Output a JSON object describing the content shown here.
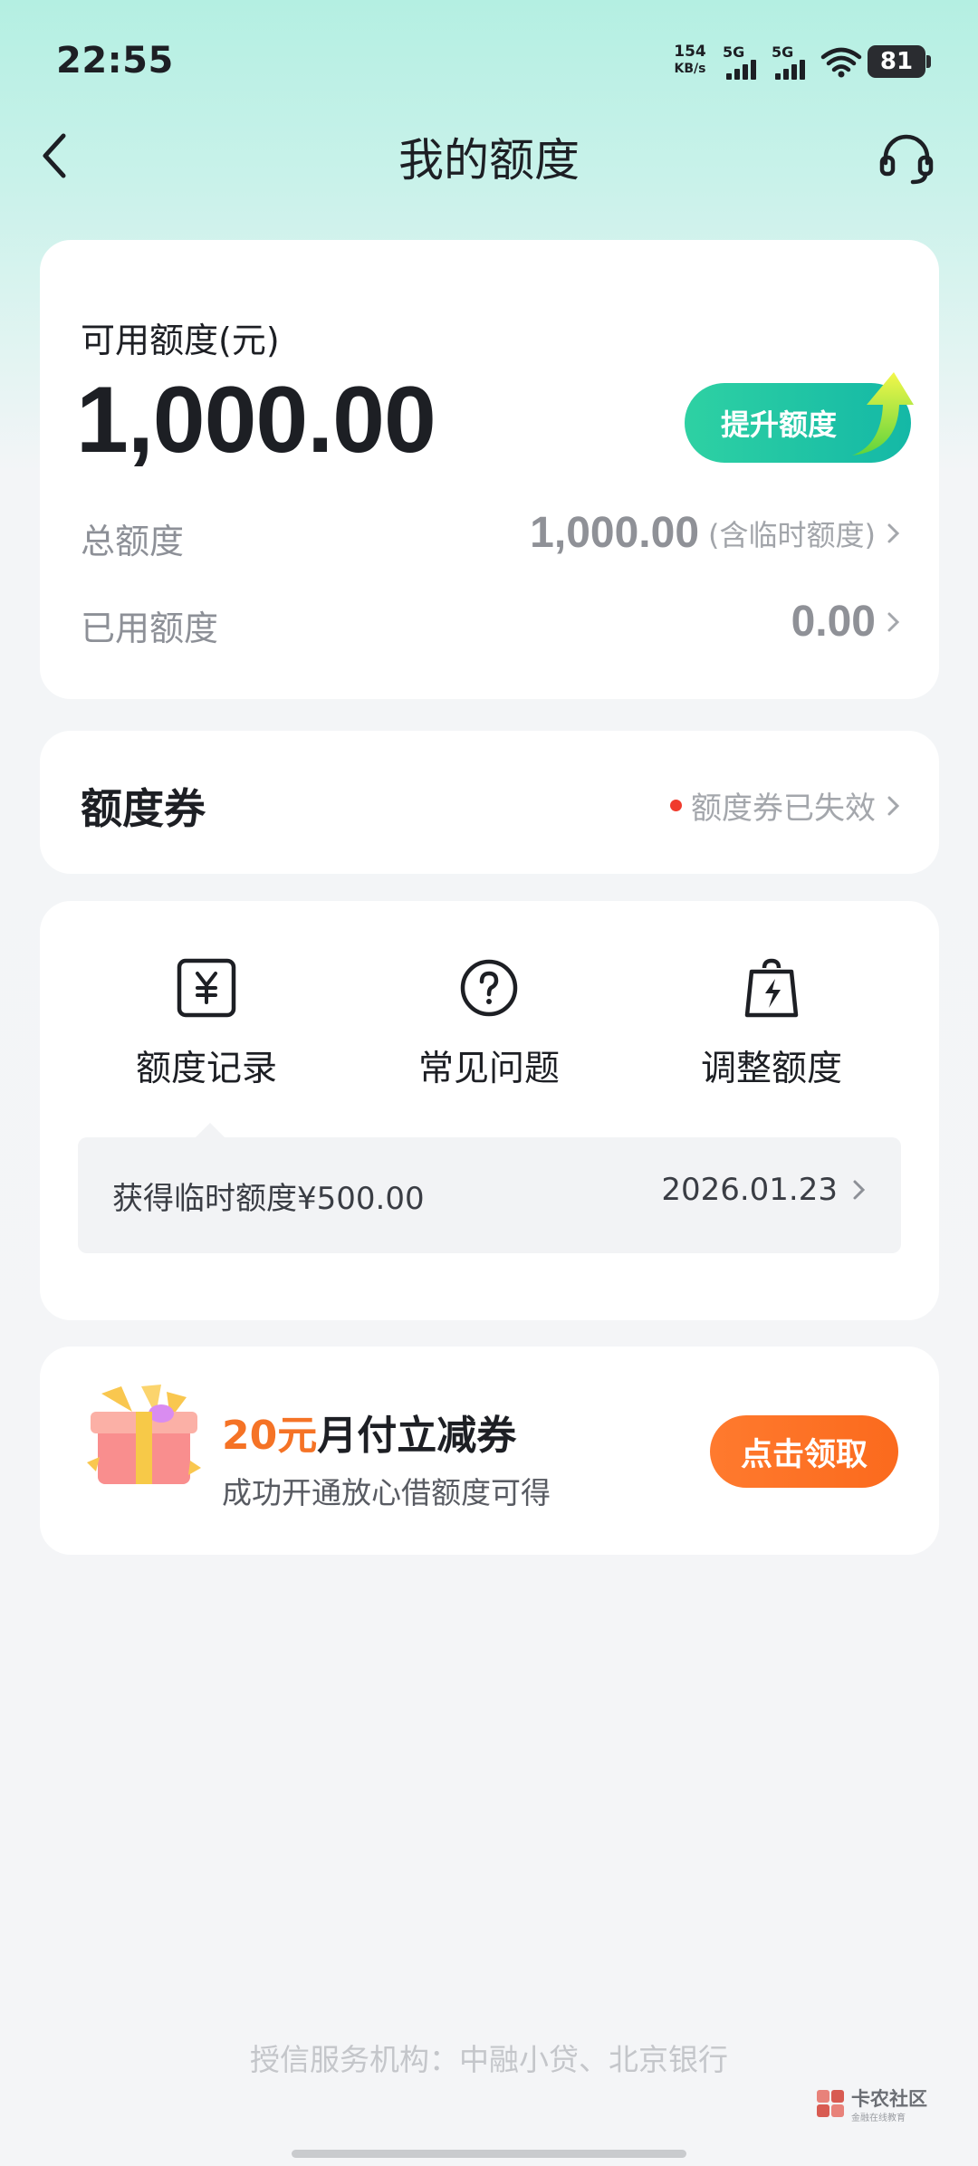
{
  "status_bar": {
    "time": "22:55",
    "net_speed_value": "154",
    "net_speed_unit": "KB/s",
    "sim1_label": "5G",
    "sim2_label": "5G",
    "battery": "81"
  },
  "header": {
    "title": "我的额度"
  },
  "limit_card": {
    "available_label": "可用额度(元)",
    "available_amount": "1,000.00",
    "raise_button": "提升额度",
    "total_label": "总额度",
    "total_value": "1,000.00",
    "total_note": "(含临时额度)",
    "used_label": "已用额度",
    "used_value": "0.00"
  },
  "coupon_card": {
    "title": "额度券",
    "status": "额度券已失效"
  },
  "actions": {
    "record_label": "额度记录",
    "faq_label": "常见问题",
    "adjust_label": "调整额度",
    "record_item_text": "获得临时额度¥500.00",
    "record_item_date": "2026.01.23"
  },
  "promo": {
    "title_highlight": "20元",
    "title_rest": "月付立减券",
    "subtitle": "成功开通放心借额度可得",
    "button": "点击领取"
  },
  "footer": {
    "text": "授信服务机构：中融小贷、北京银行"
  },
  "watermark": {
    "name": "卡农社区",
    "sub": "金融在线教育"
  },
  "colors": {
    "accent_green": "#14b8a6",
    "accent_orange": "#f57326",
    "alert_red": "#f03b2d"
  }
}
